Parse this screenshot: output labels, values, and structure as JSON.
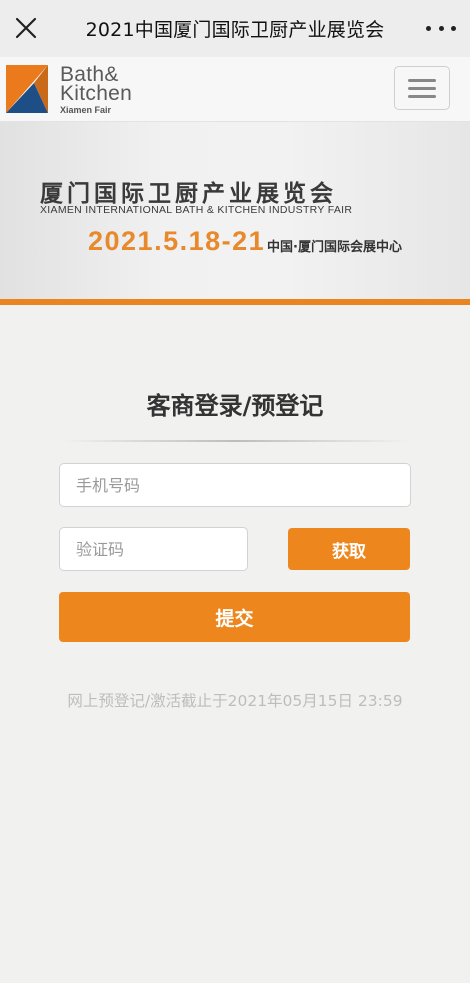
{
  "topbar": {
    "title": "2021中国厦门国际卫厨产业展览会",
    "close_icon": "close-icon",
    "more_icon": "more-dots-icon"
  },
  "logo": {
    "line1": "Bath&",
    "line2": "Kitchen",
    "line3": "Xiamen Fair",
    "colors": {
      "orange": "#ea7a1c",
      "blue": "#1e4e86"
    }
  },
  "banner": {
    "title_cn": "厦门国际卫厨产业展览会",
    "title_en": "XIAMEN INTERNATIONAL BATH & KITCHEN INDUSTRY FAIR",
    "date": "2021.5.18-21",
    "venue": "中国·厦门国际会展中心",
    "accent": "#e8892b"
  },
  "form": {
    "title": "客商登录/预登记",
    "phone_placeholder": "手机号码",
    "code_placeholder": "验证码",
    "get_code_label": "获取",
    "submit_label": "提交",
    "deadline": "网上预登记/激活截止于2021年05月15日 23:59",
    "button_color": "#ee861e"
  }
}
